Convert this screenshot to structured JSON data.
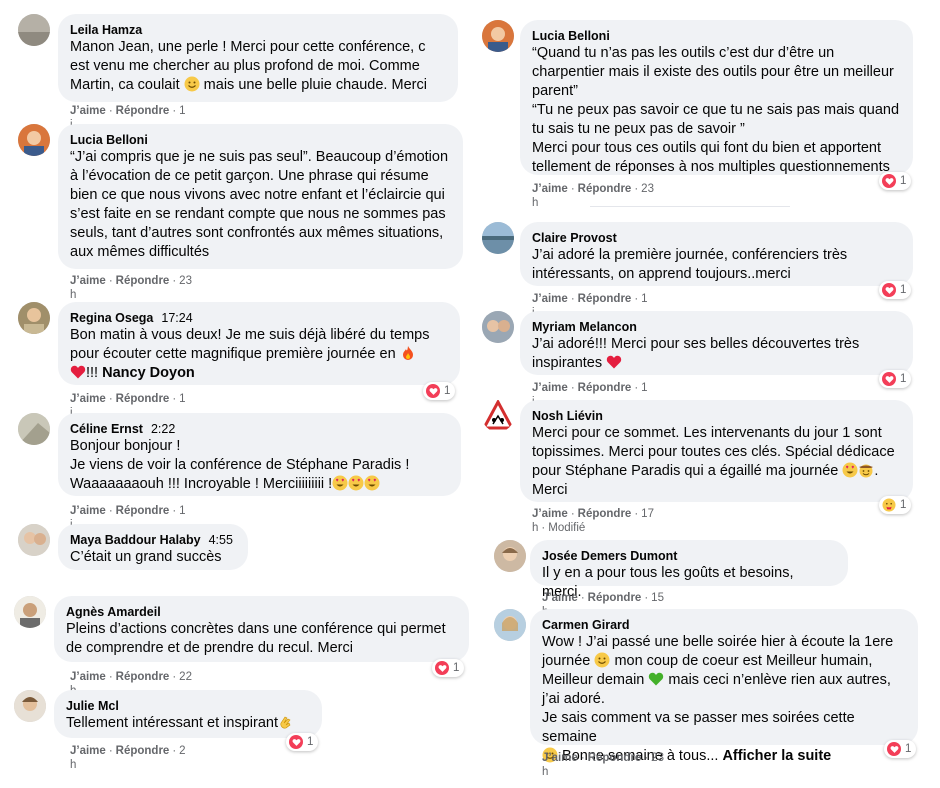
{
  "colors": {
    "bubble": "#f0f2f5",
    "meta": "#65676b",
    "heart": "#f33e58"
  },
  "actions": {
    "like": "J’aime",
    "reply": "Répondre"
  },
  "comments": [
    {
      "author": "Leila Hamza",
      "time": "",
      "text": "Manon Jean, une perle ! Merci pour cette conférence, c est venu me chercher au plus profond de moi. Comme Martin, ca coulait",
      "text2": "mais une belle pluie chaude. Merci",
      "age": "1 j",
      "reactions": ""
    },
    {
      "author": "Lucia Belloni",
      "time": "",
      "text": "“J’ai compris que je ne suis pas seul”. Beaucoup d’émotion à l’évocation de ce petit garçon. Une phrase qui résume bien ce que nous vivons avec notre enfant et l’éclaircie qui s’est faite en se rendant compte que nous ne sommes pas seuls, tant d’autres sont confrontés aux mêmes situations, aux mêmes difficultés",
      "age": "23 h",
      "reactions": ""
    },
    {
      "author": "Regina Osega",
      "time": "17:24",
      "text": "Bon matin à vous deux! Je me suis déjà libéré du temps pour écouter cette magnifique première journée en",
      "text2": "!!!",
      "mention": "Nancy Doyon",
      "age": "1 j",
      "reactions": "1"
    },
    {
      "author": "Céline Ernst",
      "time": "2:22",
      "text": "Bonjour bonjour !\nJe viens de voir la conférence de Stéphane Paradis !\nWaaaaaaaouh !!! Incroyable ! Merciiiiiiiii !",
      "age": "1 j",
      "reactions": ""
    },
    {
      "author": "Maya Baddour Halaby",
      "time": "4:55",
      "text": "C’était un grand succès",
      "age": "",
      "reactions": ""
    },
    {
      "author": "Agnès Amardeil",
      "time": "",
      "text": "Pleins d’actions concrètes dans une conférence qui permet de comprendre et de prendre du recul. Merci",
      "age": "22 h",
      "reactions": "1"
    },
    {
      "author": "Julie Mcl",
      "time": "",
      "text": "Tellement intéressant et inspirant",
      "age": "2 h",
      "reactions": "1"
    },
    {
      "author": "Lucia Belloni",
      "time": "",
      "text": "“Quand tu n’as pas les outils c’est dur d’être un charpentier mais il existe des outils pour être un meilleur parent”\n“Tu ne peux pas savoir ce que tu ne sais pas mais quand tu sais tu ne peux pas de savoir ”\nMerci pour tous ces outils qui font du bien et apportent tellement de réponses à nos multiples questionnements",
      "age": "23 h",
      "reactions": "1"
    },
    {
      "author": "Claire Provost",
      "time": "",
      "text": "J’ai adoré la première journée, conférenciers très intéressants, on apprend toujours..merci",
      "age": "1 j",
      "reactions": "1"
    },
    {
      "author": "Myriam Melancon",
      "time": "",
      "text": "J’ai adoré!!! Merci pour ses belles découvertes très inspirantes",
      "age": "1 j",
      "reactions": "1"
    },
    {
      "author": "Nosh Liévin",
      "time": "",
      "text": "Merci pour ce sommet. Les intervenants du jour 1 sont topissimes. Merci pour toutes ces clés. Spécial dédicace pour Stéphane Paradis qui a égaillé ma journée",
      "text2": ".\nMerci",
      "age": "17 h",
      "edited": "Modifié",
      "reactions": "1"
    },
    {
      "author": "Josée Demers Dumont",
      "time": "",
      "text": "Il y en a pour tous les goûts et besoins, merci.",
      "age": "15 h",
      "reactions": ""
    },
    {
      "author": "Carmen Girard",
      "time": "",
      "text": "Wow ! J’ai passé une belle soirée hier à écoute la 1ere journée",
      "text2": "mon coup de coeur est Meilleur humain, Meilleur demain",
      "text3": "mais ceci n’enlève rien aux autres, j’ai adoré.\nJe sais comment va se passer mes soirées cette semaine",
      "text4": "Bonne semaine à tous...",
      "more": "Afficher la suite",
      "age": "23 h",
      "reactions": "1"
    }
  ]
}
